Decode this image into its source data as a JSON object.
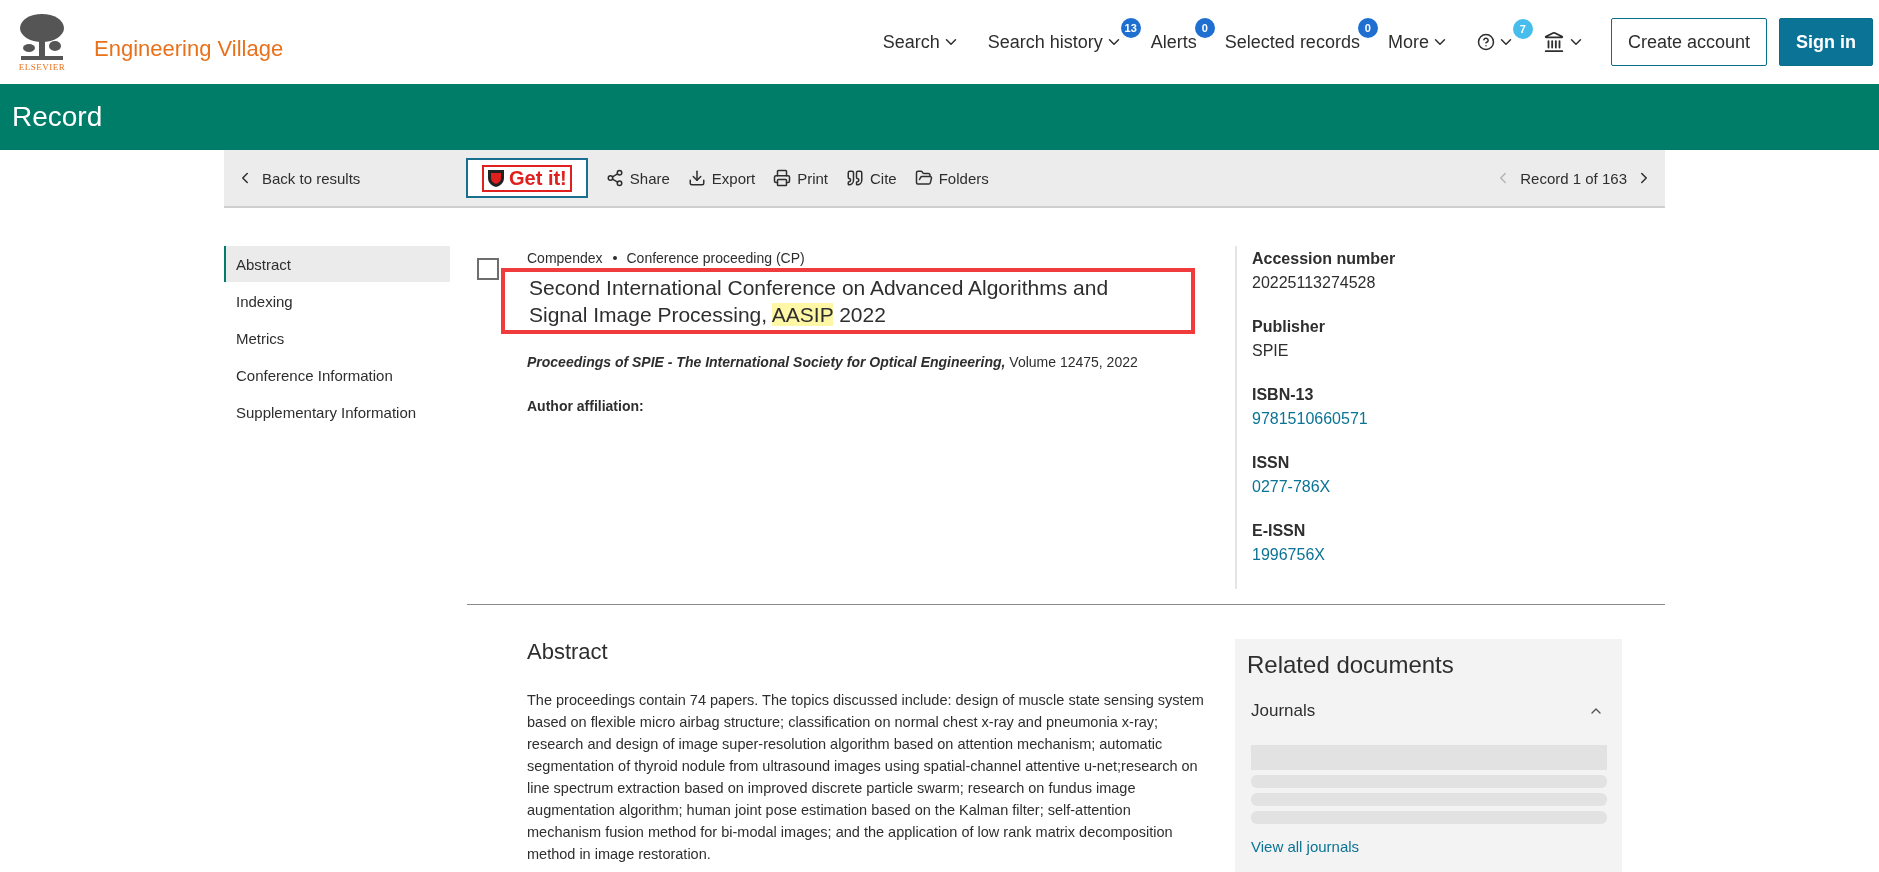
{
  "logo": {
    "publisher": "ELSEVIER",
    "product": "Engineering Village"
  },
  "nav": [
    {
      "kind": "menu",
      "label": "Search"
    },
    {
      "kind": "menu",
      "label": "Search history",
      "badge": "13",
      "color": "#1f6fd1"
    },
    {
      "kind": "link",
      "label": "Alerts",
      "badge": "0",
      "color": "#1f6fd1"
    },
    {
      "kind": "link",
      "label": "Selected records",
      "badge": "0",
      "color": "#1f6fd1"
    },
    {
      "kind": "menu",
      "label": "More"
    },
    {
      "kind": "help",
      "badge": "7",
      "color": "#46bdec"
    },
    {
      "kind": "institution"
    }
  ],
  "buttons": [
    {
      "kind": "outline",
      "label": "Create account"
    },
    {
      "kind": "filled",
      "label": "Sign in"
    }
  ],
  "page_title": "Record",
  "toolbar": {
    "back": "Back to results",
    "get_it": "Get it!",
    "actions": [
      {
        "label": "Share"
      },
      {
        "label": "Export"
      },
      {
        "label": "Print"
      },
      {
        "label": "Cite"
      },
      {
        "label": "Folders"
      }
    ],
    "pager": "Record 1 of 163"
  },
  "sections": [
    {
      "label": "Abstract",
      "selected": true
    },
    {
      "label": "Indexing",
      "selected": false
    },
    {
      "label": "Metrics",
      "selected": false
    },
    {
      "label": "Conference Information",
      "selected": false
    },
    {
      "label": "Supplementary Information",
      "selected": false
    }
  ],
  "record": {
    "checked": false,
    "database": "Compendex",
    "doc_type": "Conference proceeding (CP)",
    "title": [
      {
        "text": "Second International Conference on Advanced Algorithms and Signal Image Processing, ",
        "highlighted": false
      },
      {
        "text": "AASIP",
        "highlighted": true
      },
      {
        "text": " 2022",
        "highlighted": false
      }
    ],
    "journal": "Proceedings of SPIE - The International Society for Optical Engineering,",
    "volume": "Volume 12475, 2022",
    "affiliation_label": "Author affiliation:"
  },
  "details": [
    {
      "label": "Accession number",
      "value": "20225113274528",
      "kind": "text"
    },
    {
      "label": "Publisher",
      "value": "SPIE",
      "kind": "text"
    },
    {
      "label": "ISBN-13",
      "value": "9781510660571",
      "kind": "link"
    },
    {
      "label": "ISSN",
      "value": "0277-786X",
      "kind": "link"
    },
    {
      "label": "E-ISSN",
      "value": "1996756X",
      "kind": "link"
    }
  ],
  "abstract": {
    "heading": "Abstract",
    "text": "The proceedings contain 74 papers. The topics discussed include: design of muscle state sensing system based on flexible micro airbag structure; classification on normal chest x-ray and pneumonia x-ray; research and design of image super-resolution algorithm based on attention mechanism; automatic segmentation of thyroid nodule from ultrasound images using spatial-channel attentive u-net;research on line spectrum extraction based on improved discrete particle swarm; research on fundus image augmentation algorithm; human joint pose estimation based on the Kalman filter; self-attention mechanism fusion method for bi-modal images; and the application of low rank matrix decomposition method in image restoration."
  },
  "related": {
    "heading": "Related documents",
    "section": "Journals",
    "expanded": true,
    "link": "View all journals"
  }
}
